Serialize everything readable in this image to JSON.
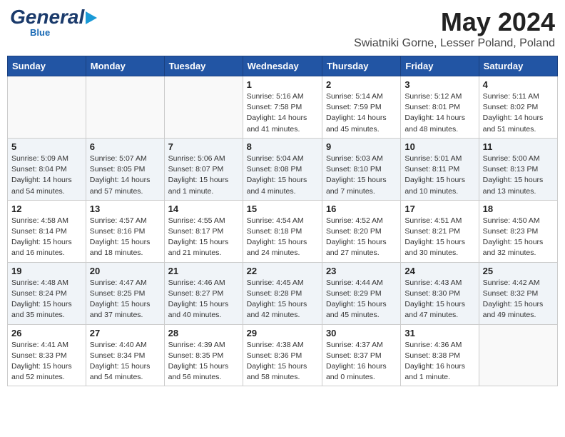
{
  "header": {
    "logo_line1": "General",
    "logo_line2": "Blue",
    "month": "May 2024",
    "location": "Swiatniki Gorne, Lesser Poland, Poland"
  },
  "weekdays": [
    "Sunday",
    "Monday",
    "Tuesday",
    "Wednesday",
    "Thursday",
    "Friday",
    "Saturday"
  ],
  "weeks": [
    [
      {
        "day": "",
        "info": ""
      },
      {
        "day": "",
        "info": ""
      },
      {
        "day": "",
        "info": ""
      },
      {
        "day": "1",
        "info": "Sunrise: 5:16 AM\nSunset: 7:58 PM\nDaylight: 14 hours\nand 41 minutes."
      },
      {
        "day": "2",
        "info": "Sunrise: 5:14 AM\nSunset: 7:59 PM\nDaylight: 14 hours\nand 45 minutes."
      },
      {
        "day": "3",
        "info": "Sunrise: 5:12 AM\nSunset: 8:01 PM\nDaylight: 14 hours\nand 48 minutes."
      },
      {
        "day": "4",
        "info": "Sunrise: 5:11 AM\nSunset: 8:02 PM\nDaylight: 14 hours\nand 51 minutes."
      }
    ],
    [
      {
        "day": "5",
        "info": "Sunrise: 5:09 AM\nSunset: 8:04 PM\nDaylight: 14 hours\nand 54 minutes."
      },
      {
        "day": "6",
        "info": "Sunrise: 5:07 AM\nSunset: 8:05 PM\nDaylight: 14 hours\nand 57 minutes."
      },
      {
        "day": "7",
        "info": "Sunrise: 5:06 AM\nSunset: 8:07 PM\nDaylight: 15 hours\nand 1 minute."
      },
      {
        "day": "8",
        "info": "Sunrise: 5:04 AM\nSunset: 8:08 PM\nDaylight: 15 hours\nand 4 minutes."
      },
      {
        "day": "9",
        "info": "Sunrise: 5:03 AM\nSunset: 8:10 PM\nDaylight: 15 hours\nand 7 minutes."
      },
      {
        "day": "10",
        "info": "Sunrise: 5:01 AM\nSunset: 8:11 PM\nDaylight: 15 hours\nand 10 minutes."
      },
      {
        "day": "11",
        "info": "Sunrise: 5:00 AM\nSunset: 8:13 PM\nDaylight: 15 hours\nand 13 minutes."
      }
    ],
    [
      {
        "day": "12",
        "info": "Sunrise: 4:58 AM\nSunset: 8:14 PM\nDaylight: 15 hours\nand 16 minutes."
      },
      {
        "day": "13",
        "info": "Sunrise: 4:57 AM\nSunset: 8:16 PM\nDaylight: 15 hours\nand 18 minutes."
      },
      {
        "day": "14",
        "info": "Sunrise: 4:55 AM\nSunset: 8:17 PM\nDaylight: 15 hours\nand 21 minutes."
      },
      {
        "day": "15",
        "info": "Sunrise: 4:54 AM\nSunset: 8:18 PM\nDaylight: 15 hours\nand 24 minutes."
      },
      {
        "day": "16",
        "info": "Sunrise: 4:52 AM\nSunset: 8:20 PM\nDaylight: 15 hours\nand 27 minutes."
      },
      {
        "day": "17",
        "info": "Sunrise: 4:51 AM\nSunset: 8:21 PM\nDaylight: 15 hours\nand 30 minutes."
      },
      {
        "day": "18",
        "info": "Sunrise: 4:50 AM\nSunset: 8:23 PM\nDaylight: 15 hours\nand 32 minutes."
      }
    ],
    [
      {
        "day": "19",
        "info": "Sunrise: 4:48 AM\nSunset: 8:24 PM\nDaylight: 15 hours\nand 35 minutes."
      },
      {
        "day": "20",
        "info": "Sunrise: 4:47 AM\nSunset: 8:25 PM\nDaylight: 15 hours\nand 37 minutes."
      },
      {
        "day": "21",
        "info": "Sunrise: 4:46 AM\nSunset: 8:27 PM\nDaylight: 15 hours\nand 40 minutes."
      },
      {
        "day": "22",
        "info": "Sunrise: 4:45 AM\nSunset: 8:28 PM\nDaylight: 15 hours\nand 42 minutes."
      },
      {
        "day": "23",
        "info": "Sunrise: 4:44 AM\nSunset: 8:29 PM\nDaylight: 15 hours\nand 45 minutes."
      },
      {
        "day": "24",
        "info": "Sunrise: 4:43 AM\nSunset: 8:30 PM\nDaylight: 15 hours\nand 47 minutes."
      },
      {
        "day": "25",
        "info": "Sunrise: 4:42 AM\nSunset: 8:32 PM\nDaylight: 15 hours\nand 49 minutes."
      }
    ],
    [
      {
        "day": "26",
        "info": "Sunrise: 4:41 AM\nSunset: 8:33 PM\nDaylight: 15 hours\nand 52 minutes."
      },
      {
        "day": "27",
        "info": "Sunrise: 4:40 AM\nSunset: 8:34 PM\nDaylight: 15 hours\nand 54 minutes."
      },
      {
        "day": "28",
        "info": "Sunrise: 4:39 AM\nSunset: 8:35 PM\nDaylight: 15 hours\nand 56 minutes."
      },
      {
        "day": "29",
        "info": "Sunrise: 4:38 AM\nSunset: 8:36 PM\nDaylight: 15 hours\nand 58 minutes."
      },
      {
        "day": "30",
        "info": "Sunrise: 4:37 AM\nSunset: 8:37 PM\nDaylight: 16 hours\nand 0 minutes."
      },
      {
        "day": "31",
        "info": "Sunrise: 4:36 AM\nSunset: 8:38 PM\nDaylight: 16 hours\nand 1 minute."
      },
      {
        "day": "",
        "info": ""
      }
    ]
  ]
}
